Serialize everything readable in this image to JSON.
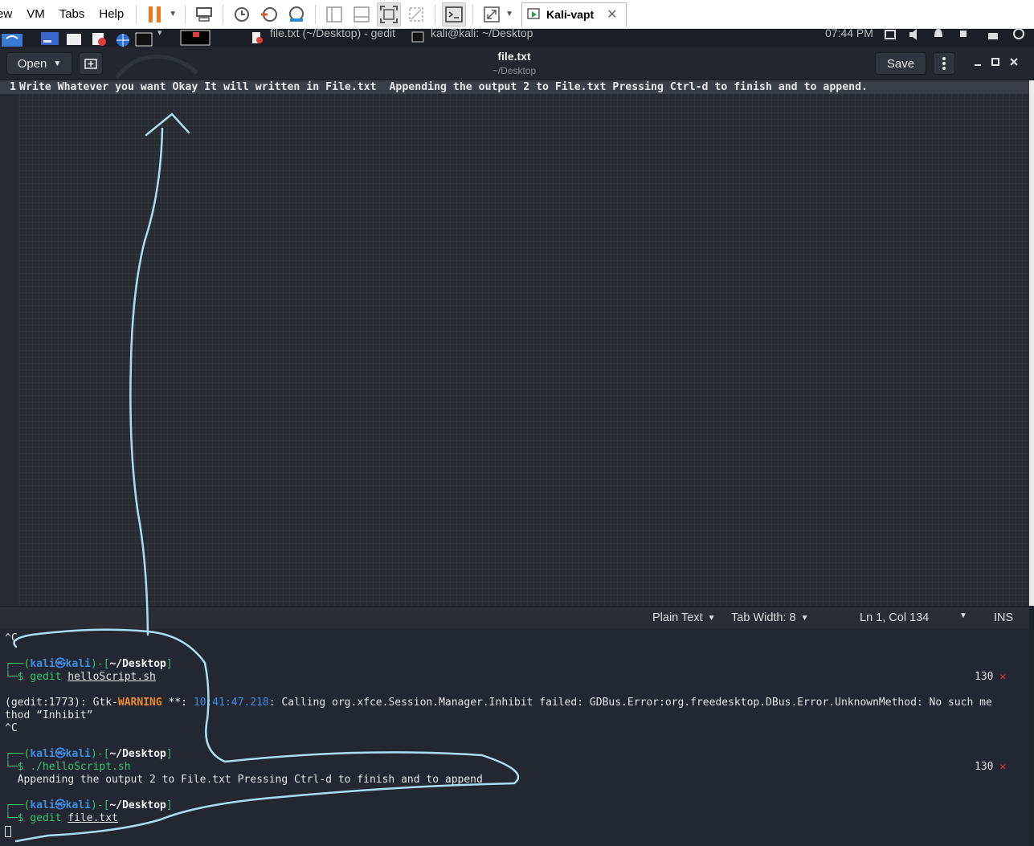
{
  "host": {
    "menu": [
      "ew",
      "VM",
      "Tabs",
      "Help"
    ],
    "tab_label": "Kali-vapt",
    "tab_close": "✕"
  },
  "panel": {
    "window1": "file.txt (~/Desktop) - gedit",
    "window2": "kali@kali: ~/Desktop",
    "clock": "07:44 PM"
  },
  "gedit": {
    "open_label": "Open",
    "save_label": "Save",
    "title": "file.txt",
    "subtitle": "~/Desktop",
    "line_number": "1",
    "line_text": "Write Whatever you want Okay It will written in File.txt  Appending the output 2 to File.txt Pressing Ctrl-d to finish and to append.",
    "status": {
      "language": "Plain Text",
      "tab_width": "Tab Width: 8",
      "position": "Ln 1, Col 134",
      "mode": "INS"
    }
  },
  "terminal": {
    "ctrl_c": "^C",
    "user": "kali",
    "host": "kali",
    "dir": "~/Desktop",
    "prompt_top": "┌──(",
    "prompt_mid": ")-[",
    "prompt_end": "]",
    "prompt_bottom": "└─$",
    "cmd1_name": "gedit",
    "cmd1_arg": "helloScript.sh",
    "exit_code": "130",
    "exit_mark": "✕",
    "warn_prefix": "(gedit:1773): Gtk-",
    "warn_word": "WARNING",
    "warn_stars": " **: ",
    "warn_time": "10:41:47.218",
    "warn_rest": ": Calling org.xfce.Session.Manager.Inhibit failed: GDBus.Error:org.freedesktop.DBus.Error.UnknownMethod: No such me",
    "warn_rest2": "thod “Inhibit”",
    "cmd2": "./helloScript.sh",
    "output": "  Appending the output 2 to File.txt Pressing Ctrl-d to finish and to append",
    "cmd3_name": "gedit",
    "cmd3_arg": "file.txt"
  },
  "colors": {
    "annotation": "#a9def0",
    "prompt_blue": "#3e8fe6",
    "prompt_green": "#35c56e",
    "warning_orange": "#f08a24"
  }
}
